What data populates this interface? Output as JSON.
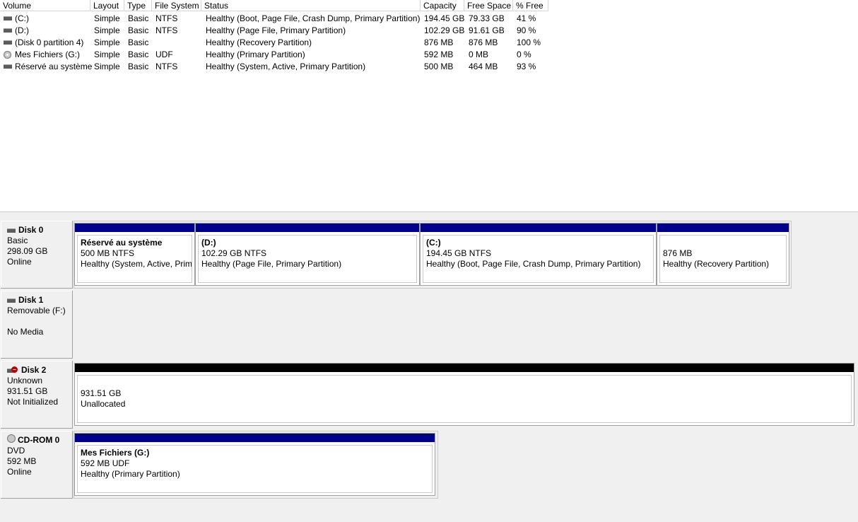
{
  "columns": [
    "Volume",
    "Layout",
    "Type",
    "File System",
    "Status",
    "Capacity",
    "Free Space",
    "% Free"
  ],
  "volumes": [
    {
      "icon": "hard-disk-icon",
      "name": " (C:)",
      "layout": "Simple",
      "type": "Basic",
      "fs": "NTFS",
      "status": "Healthy (Boot, Page File, Crash Dump, Primary Partition)",
      "capacity": "194.45 GB",
      "free": "79.33 GB",
      "pct": "41 %"
    },
    {
      "icon": "hard-disk-icon",
      "name": " (D:)",
      "layout": "Simple",
      "type": "Basic",
      "fs": "NTFS",
      "status": "Healthy (Page File, Primary Partition)",
      "capacity": "102.29 GB",
      "free": "91.61 GB",
      "pct": "90 %"
    },
    {
      "icon": "hard-disk-icon",
      "name": "(Disk 0 partition 4)",
      "layout": "Simple",
      "type": "Basic",
      "fs": "",
      "status": "Healthy (Recovery Partition)",
      "capacity": "876 MB",
      "free": "876 MB",
      "pct": "100 %"
    },
    {
      "icon": "cd-icon",
      "name": "Mes Fichiers (G:)",
      "layout": "Simple",
      "type": "Basic",
      "fs": "UDF",
      "status": "Healthy (Primary Partition)",
      "capacity": "592 MB",
      "free": "0 MB",
      "pct": "0 %"
    },
    {
      "icon": "hard-disk-icon",
      "name": "Réservé au système",
      "layout": "Simple",
      "type": "Basic",
      "fs": "NTFS",
      "status": "Healthy (System, Active, Primary Partition)",
      "capacity": "500 MB",
      "free": "464 MB",
      "pct": "93 %"
    }
  ],
  "disks": [
    {
      "name": "Disk 0",
      "line1": "Basic",
      "line2": "298.09 GB",
      "line3": "Online",
      "partitions": [
        {
          "title": "Réservé au système",
          "size": "500 MB NTFS",
          "status": "Healthy (System, Active, Prim"
        },
        {
          "title": " (D:)",
          "size": "102.29 GB NTFS",
          "status": "Healthy (Page File, Primary Partition)"
        },
        {
          "title": " (C:)",
          "size": "194.45 GB NTFS",
          "status": "Healthy (Boot, Page File, Crash Dump, Primary Partition)"
        },
        {
          "title": "",
          "size": "876 MB",
          "status": "Healthy (Recovery Partition)"
        }
      ]
    },
    {
      "name": "Disk 1",
      "line1": "Removable (F:)",
      "line2": "",
      "line3": "No Media"
    },
    {
      "name": "Disk 2",
      "line1": "Unknown",
      "line2": "931.51 GB",
      "line3": "Not Initialized",
      "partitions": [
        {
          "title": "",
          "size": "931.51 GB",
          "status": "Unallocated"
        }
      ]
    },
    {
      "name": "CD-ROM 0",
      "line1": "DVD",
      "line2": "592 MB",
      "line3": "Online",
      "partitions": [
        {
          "title": "Mes Fichiers  (G:)",
          "size": "592 MB UDF",
          "status": "Healthy (Primary Partition)"
        }
      ]
    }
  ],
  "colors": {
    "primary_partition": "#00008b",
    "unallocated": "#000000",
    "error_badge": "#c00000"
  }
}
